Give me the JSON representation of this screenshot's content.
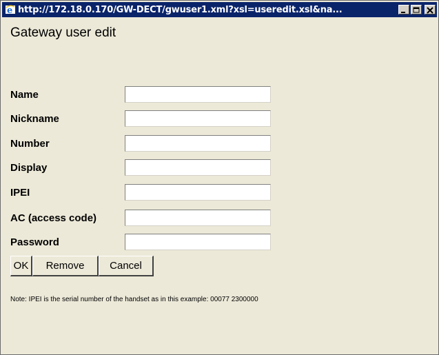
{
  "window": {
    "title": "http://172.18.0.170/GW-DECT/gwuser1.xml?xsl=useredit.xsl&na...",
    "minimize_glyph": "_",
    "maximize_glyph": "□",
    "close_glyph": "×"
  },
  "page": {
    "heading": "Gateway user edit"
  },
  "form": {
    "fields": [
      {
        "label": "Name",
        "value": ""
      },
      {
        "label": "Nickname",
        "value": ""
      },
      {
        "label": "Number",
        "value": ""
      },
      {
        "label": "Display",
        "value": ""
      },
      {
        "label": "IPEI",
        "value": ""
      },
      {
        "label": "AC (access code)",
        "value": ""
      },
      {
        "label": "Password",
        "value": ""
      }
    ]
  },
  "buttons": {
    "ok": "OK",
    "remove": "Remove",
    "cancel": "Cancel"
  },
  "note": "Note: IPEI is the serial number of the handset as in this example: 00077 2300000",
  "colors": {
    "titlebar": "#0a246a",
    "window_bg": "#ece9d8"
  }
}
